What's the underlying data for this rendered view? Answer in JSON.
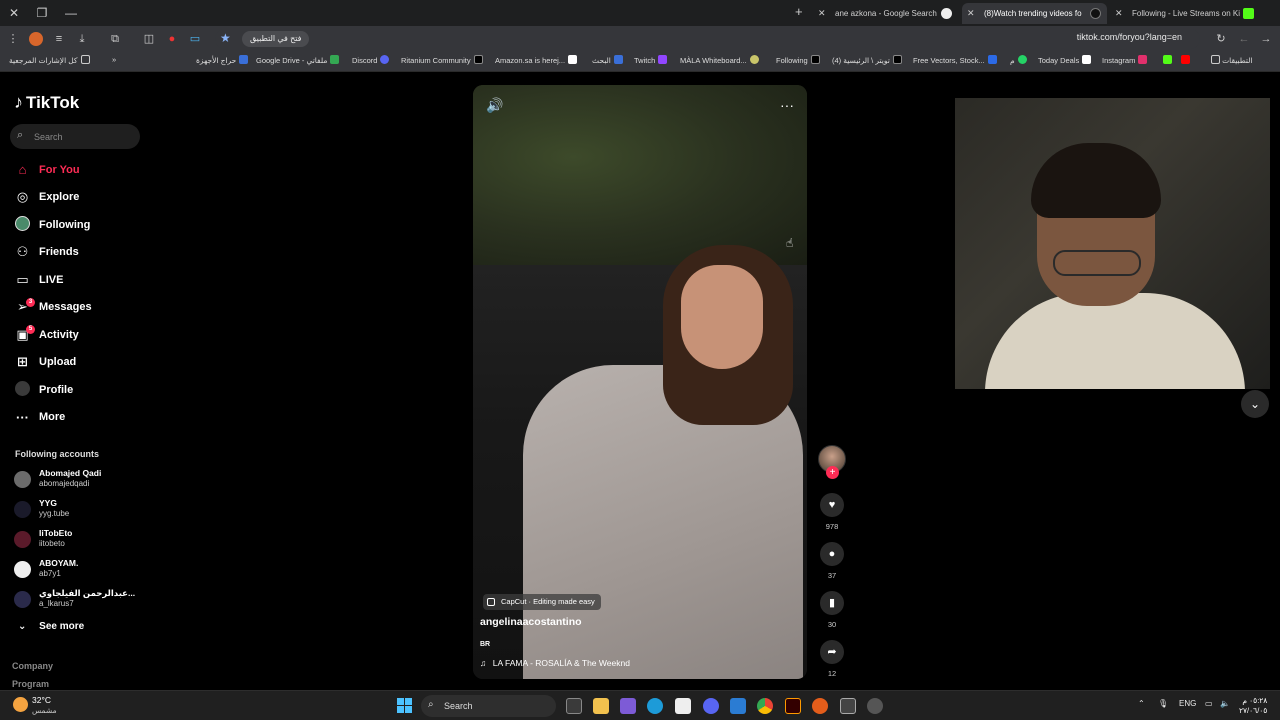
{
  "browser": {
    "tabs": [
      {
        "label": "ane azkona - Google Search",
        "active": false
      },
      {
        "label": "(8)Watch trending videos fo",
        "active": true
      },
      {
        "label": "Following - Live Streams on Ki",
        "active": false
      }
    ],
    "open_in_app": "فتح في التطبيق",
    "url": "tiktok.com/foryou?lang=en",
    "bookmarks": [
      "كل الإشارات المرجعية",
      "حراج الأجهزة",
      "Google Drive - ملفاتي",
      "Discord",
      "Ritanium Community",
      "Amazon.sa is herej...",
      "البحث",
      "Twitch",
      "MÀLA Whiteboard...",
      "Following",
      "(4) تويتر \\ الرئيسية",
      "Free Vectors, Stock...",
      "م",
      "Today Deals",
      "Instagram",
      "التطبيقات"
    ]
  },
  "tiktok": {
    "logo": "TikTok",
    "search_placeholder": "Search",
    "nav": [
      {
        "label": "For You",
        "icon": "home-icon",
        "active": true,
        "badge": ""
      },
      {
        "label": "Explore",
        "icon": "compass-icon",
        "active": false,
        "badge": ""
      },
      {
        "label": "Following",
        "icon": "following-avatar-icon",
        "active": false,
        "badge": ""
      },
      {
        "label": "Friends",
        "icon": "friends-icon",
        "active": false,
        "badge": ""
      },
      {
        "label": "LIVE",
        "icon": "live-icon",
        "active": false,
        "badge": ""
      },
      {
        "label": "Messages",
        "icon": "messages-icon",
        "active": false,
        "badge": "3"
      },
      {
        "label": "Activity",
        "icon": "activity-icon",
        "active": false,
        "badge": "5"
      },
      {
        "label": "Upload",
        "icon": "upload-icon",
        "active": false,
        "badge": ""
      },
      {
        "label": "Profile",
        "icon": "profile-icon",
        "active": false,
        "badge": ""
      },
      {
        "label": "More",
        "icon": "more-icon",
        "active": false,
        "badge": ""
      }
    ],
    "following_title": "Following accounts",
    "accounts": [
      {
        "name": "Abomajed Qadi",
        "handle": "abomajedqadi"
      },
      {
        "name": "YYG",
        "handle": "yyg.tube"
      },
      {
        "name": "IiTobEto",
        "handle": "iitobeto"
      },
      {
        "name": "ABOYAM.",
        "handle": "ab7y1"
      },
      {
        "name": "عبدالرحمن الفيلجاوي...",
        "handle": "a_lkarus7"
      }
    ],
    "see_more": "See more",
    "footer": [
      "Company",
      "Program"
    ],
    "video": {
      "capcut": "CapCut · Editing made easy",
      "author": "angelinaacostantino",
      "description": "BR",
      "music": "LA FAMA - ROSALÍA & The Weeknd",
      "likes": "978",
      "comments": "37",
      "saves": "30",
      "shares": "12"
    }
  },
  "taskbar": {
    "weather_temp": "32°C",
    "weather_desc": "مشمس",
    "search_label": "Search",
    "lang": "ENG",
    "time": "٠٥:٢٨ م",
    "date": "٢٧/٠٦/٠٥"
  },
  "colors": {
    "accent": "#fe2c55",
    "background": "#000000",
    "chrome": "#35363a"
  }
}
